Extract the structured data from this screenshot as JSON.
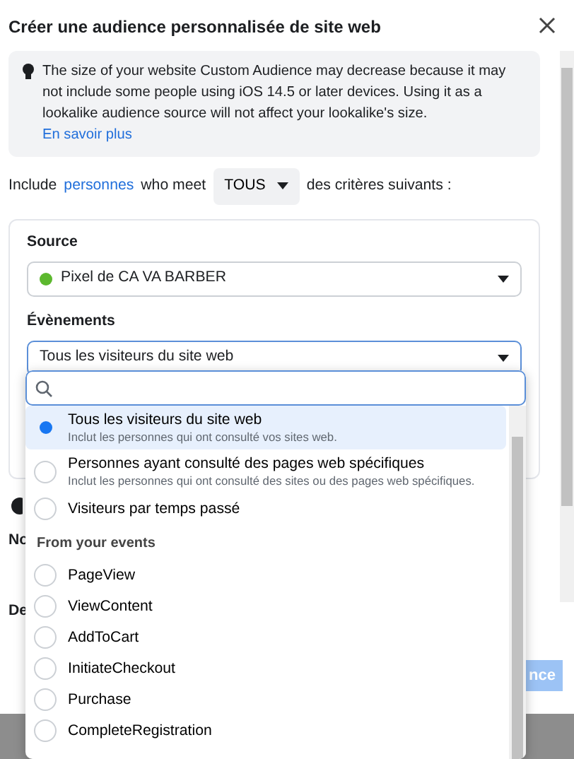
{
  "dialog": {
    "title": "Créer une audience personnalisée de site web"
  },
  "notice": {
    "text": "The size of your website Custom Audience may decrease because it may not include some people using iOS 14.5 or later devices. Using it as a lookalike audience source will not affect your lookalike's size.",
    "link": "En savoir plus"
  },
  "include_rule": {
    "prefix": "Include",
    "link": "personnes",
    "middle": "who meet",
    "match": "TOUS",
    "suffix": "des critères suivants :"
  },
  "source": {
    "label": "Source",
    "value": "Pixel de CA VA BARBER",
    "color": "#5cb82e"
  },
  "events": {
    "label": "Évènements",
    "value": "Tous les visiteurs du site web"
  },
  "hidden_fields": [
    {
      "label": "No"
    },
    {
      "label": "De"
    }
  ],
  "footer": {
    "primary_button": "nce"
  },
  "dropdown": {
    "options": [
      {
        "kind": "option",
        "label": "Tous les visiteurs du site web",
        "description": "Inclut les personnes qui ont consulté vos sites web.",
        "selected": true
      },
      {
        "kind": "option",
        "label": "Personnes ayant consulté des pages web spécifiques",
        "description": "Inclut les personnes qui ont consulté des sites ou des pages web spécifiques.",
        "selected": false
      },
      {
        "kind": "option",
        "label": "Visiteurs par temps passé",
        "selected": false
      },
      {
        "kind": "header",
        "label": "From your events"
      },
      {
        "kind": "option",
        "label": "PageView",
        "selected": false
      },
      {
        "kind": "option",
        "label": "ViewContent",
        "selected": false
      },
      {
        "kind": "option",
        "label": "AddToCart",
        "selected": false
      },
      {
        "kind": "option",
        "label": "InitiateCheckout",
        "selected": false
      },
      {
        "kind": "option",
        "label": "Purchase",
        "selected": false
      },
      {
        "kind": "option",
        "label": "CompleteRegistration",
        "selected": false
      }
    ]
  }
}
